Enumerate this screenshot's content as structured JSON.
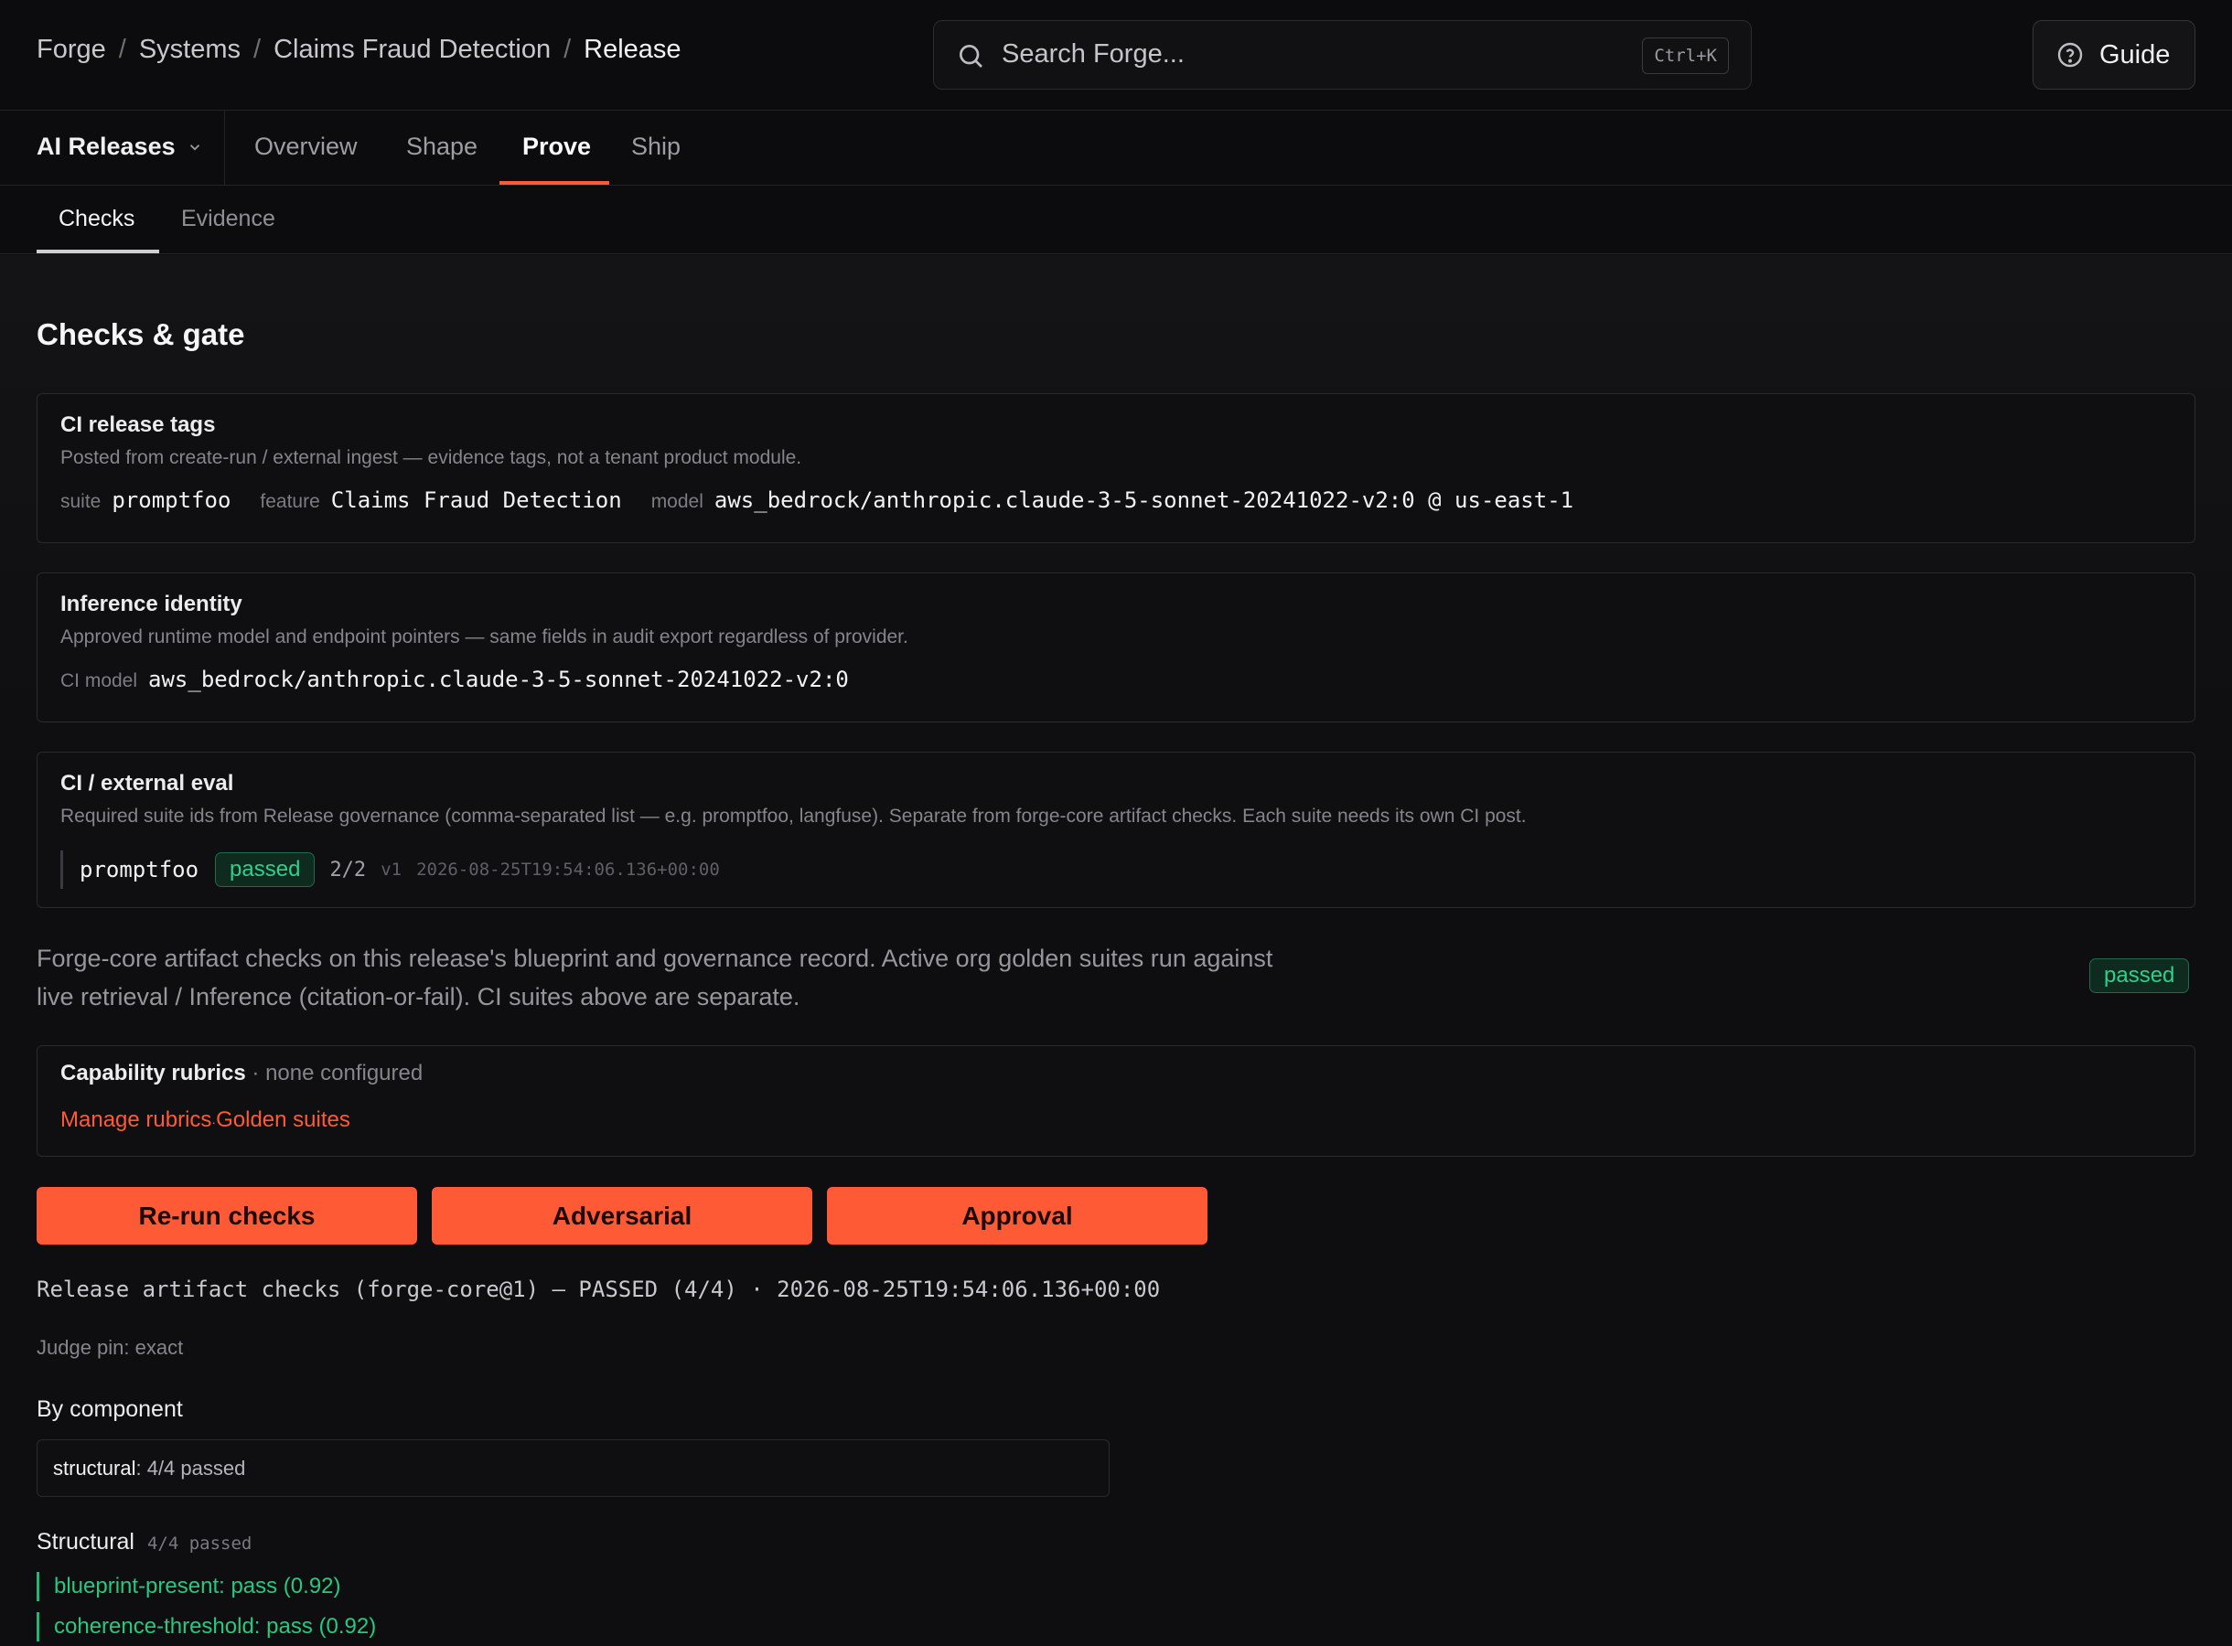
{
  "breadcrumb": [
    "Forge",
    "Systems",
    "Claims Fraud Detection",
    "Release"
  ],
  "search": {
    "placeholder": "Search Forge...",
    "shortcut": "Ctrl+K"
  },
  "guide_label": "Guide",
  "nav": {
    "selector": "AI Releases",
    "tabs": [
      {
        "label": "Overview",
        "active": false
      },
      {
        "label": "Shape",
        "active": false
      },
      {
        "label": "Prove",
        "active": true
      },
      {
        "label": "Ship",
        "active": false
      }
    ]
  },
  "subtabs": [
    {
      "label": "Checks",
      "active": true
    },
    {
      "label": "Evidence",
      "active": false
    }
  ],
  "page_title": "Checks & gate",
  "ci_tags": {
    "title": "CI release tags",
    "description": "Posted from create-run / external ingest — evidence tags, not a tenant product module.",
    "suite_key": "suite",
    "suite": "promptfoo",
    "feature_key": "feature",
    "feature": "Claims Fraud Detection",
    "model_key": "model",
    "model": "aws_bedrock/anthropic.claude-3-5-sonnet-20241022-v2:0 @ us-east-1"
  },
  "inference": {
    "title": "Inference identity",
    "description": "Approved runtime model and endpoint pointers — same fields in audit export regardless of provider.",
    "ci_model_key": "CI model",
    "ci_model": "aws_bedrock/anthropic.claude-3-5-sonnet-20241022-v2:0"
  },
  "external_eval": {
    "title": "CI / external eval",
    "description": "Required suite ids from Release governance (comma-separated list — e.g. promptfoo, langfuse). Separate from forge-core artifact checks. Each suite needs its own CI post.",
    "suite": "promptfoo",
    "status": "passed",
    "count": "2/2",
    "version": "v1",
    "timestamp": "2026-08-25T19:54:06.136+00:00"
  },
  "forge_core": {
    "description": "Forge-core artifact checks on this release's blueprint and governance record. Active org golden suites run against live retrieval / Inference (citation-or-fail). CI suites above are separate.",
    "status": "passed"
  },
  "rubrics": {
    "title": "Capability rubrics",
    "note": " · none configured",
    "link_manage": "Manage rubrics",
    "link_sep": "·",
    "link_golden": "Golden suites"
  },
  "actions": {
    "rerun": "Re-run checks",
    "adversarial": "Adversarial",
    "approval": "Approval"
  },
  "run_summary": "Release artifact checks (forge-core@1) — PASSED (4/4) · 2026-08-25T19:54:06.136+00:00",
  "judge_pin": "Judge pin: exact",
  "by_component": {
    "title": "By component",
    "name": "structural",
    "summary": ": 4/4 passed"
  },
  "structural": {
    "title": "Structural",
    "summary": "4/4 passed",
    "items": [
      "blueprint-present: pass (0.92)",
      "coherence-threshold: pass (0.92)"
    ]
  },
  "colors": {
    "accent": "#ff5a36",
    "pass": "#27c880",
    "background": "#0e0e10"
  }
}
